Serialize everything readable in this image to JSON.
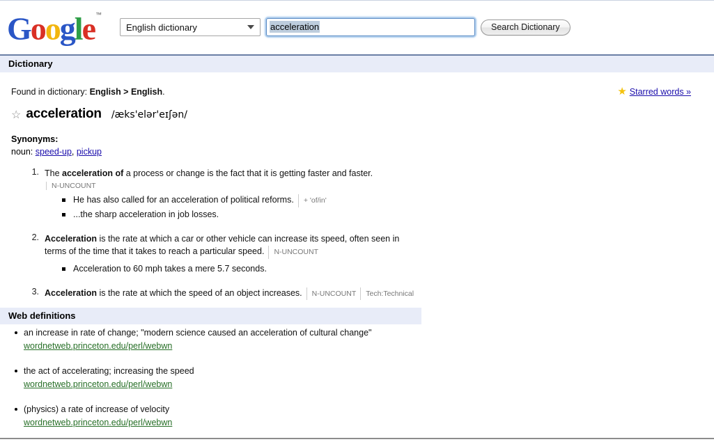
{
  "header": {
    "logo_parts": [
      {
        "char": "G",
        "color": "blue"
      },
      {
        "char": "o",
        "color": "red"
      },
      {
        "char": "o",
        "color": "yellow"
      },
      {
        "char": "g",
        "color": "blue"
      },
      {
        "char": "l",
        "color": "green"
      },
      {
        "char": "e",
        "color": "red"
      }
    ],
    "logo_tm": "™",
    "language_select_value": "English dictionary",
    "search_value": "acceleration",
    "search_placeholder": "",
    "search_button_label": "Search Dictionary"
  },
  "section_bar": {
    "title": "Dictionary"
  },
  "found": {
    "prefix": "Found in dictionary: ",
    "path": "English > English",
    "suffix": "."
  },
  "starred": {
    "icon": "star-filled-icon",
    "label": "Starred words »"
  },
  "entry": {
    "star_icon": "star-outline-icon",
    "headword": "acceleration",
    "phonetic": "/æks'elər'eɪʃən/"
  },
  "synonyms": {
    "title": "Synonyms:",
    "pos": "noun:",
    "items": [
      "speed-up",
      "pickup"
    ],
    "separator": ", "
  },
  "definitions": [
    {
      "number": "1.",
      "text_parts": [
        {
          "text": "The ",
          "bold": false
        },
        {
          "text": "acceleration of",
          "bold": true
        },
        {
          "text": " a process or change is the fact that it is getting faster and faster.",
          "bold": false
        }
      ],
      "tag_block": "N-UNCOUNT",
      "inline_tags": [],
      "examples": [
        {
          "text": "He has also called for an acceleration of political reforms.",
          "tag": "+ 'of/in'"
        },
        {
          "text": "...the sharp acceleration in job losses.",
          "tag": ""
        }
      ]
    },
    {
      "number": "2.",
      "text_parts": [
        {
          "text": "Acceleration",
          "bold": true
        },
        {
          "text": " is the rate at which a car or other vehicle can increase its speed, often seen in terms of the time that it takes to reach a particular speed.",
          "bold": false
        }
      ],
      "tag_block": "",
      "inline_tags": [
        "N-UNCOUNT"
      ],
      "examples": [
        {
          "text": "Acceleration to 60 mph takes a mere 5.7 seconds.",
          "tag": ""
        }
      ]
    },
    {
      "number": "3.",
      "text_parts": [
        {
          "text": "Acceleration",
          "bold": true
        },
        {
          "text": " is the rate at which the speed of an object increases.",
          "bold": false
        }
      ],
      "tag_block": "",
      "inline_tags": [
        "N-UNCOUNT",
        "Tech:Technical"
      ],
      "examples": []
    }
  ],
  "web_definitions": {
    "title": "Web definitions",
    "items": [
      {
        "text": "an increase in rate of change; \"modern science caused an acceleration of cultural change\"",
        "url": "wordnetweb.princeton.edu/perl/webwn"
      },
      {
        "text": "the act of accelerating; increasing the speed",
        "url": "wordnetweb.princeton.edu/perl/webwn"
      },
      {
        "text": "(physics) a rate of increase of velocity",
        "url": "wordnetweb.princeton.edu/perl/webwn"
      }
    ]
  },
  "colors": {
    "link_blue": "#1a0dab",
    "link_green": "#276f27",
    "bar_bg": "#e8ecf8",
    "rule_blue": "#6a7fa5",
    "star_gold": "#f4c20d",
    "logo_blue": "#2a56c6",
    "logo_red": "#d93025",
    "logo_yellow": "#f2b50e",
    "logo_green": "#2e9e47"
  }
}
